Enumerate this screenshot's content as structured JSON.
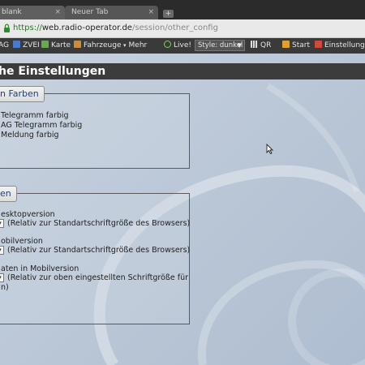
{
  "browser": {
    "tabs": [
      {
        "label": "blank",
        "close": "×"
      },
      {
        "label": "Neuer Tab",
        "close": "×"
      }
    ],
    "new_tab_label": "+",
    "url": {
      "scheme": "https://",
      "host": "web.radio-operator.de",
      "path": "/session/other_config"
    }
  },
  "bookmarks": {
    "items": [
      {
        "label": "AG",
        "icon": "bookmark-icon",
        "color": "#d05a2a"
      },
      {
        "label": "ZVEI",
        "icon": "zvei-icon",
        "color": "#4a7bc8"
      },
      {
        "label": "Karte",
        "icon": "map-icon",
        "color": "#6aa84f"
      },
      {
        "label": "Fahrzeuge",
        "icon": "vehicle-icon",
        "color": "#c98c3a"
      },
      {
        "label": "Mehr",
        "icon": "chevron-down-icon",
        "color": "#cccccc"
      },
      {
        "label": "Live!",
        "icon": "live-icon",
        "color": "#7fcf5f"
      },
      {
        "label": "QR",
        "icon": "qr-icon",
        "color": "#dddddd"
      },
      {
        "label": "Start",
        "icon": "home-icon",
        "color": "#e0a030"
      },
      {
        "label": "Einstellungen",
        "icon": "settings-icon",
        "color": "#d04a3a"
      }
    ],
    "style_select": {
      "value": "Style: dunkel"
    }
  },
  "page": {
    "title": "he Einstellungen",
    "section_colors": {
      "legend": "n Farben",
      "lines": [
        "Telegramm farbig",
        "AG Telegramm farbig",
        "Meldung farbig"
      ]
    },
    "section_fonts": {
      "legend": "en",
      "desktop_label": "esktopversion",
      "desktop_hint": "(Relativ zur Standartschriftgröße des Browsers)",
      "mobile_label": "obilversion",
      "mobile_hint": "(Relativ zur Standartschriftgröße des Browsers)",
      "mobile_data_label": "aten in Mobilversion",
      "mobile_data_hint": "(Relativ zur oben eingestellten Schriftgröße für",
      "mobile_data_hint_cont": "n)"
    }
  }
}
